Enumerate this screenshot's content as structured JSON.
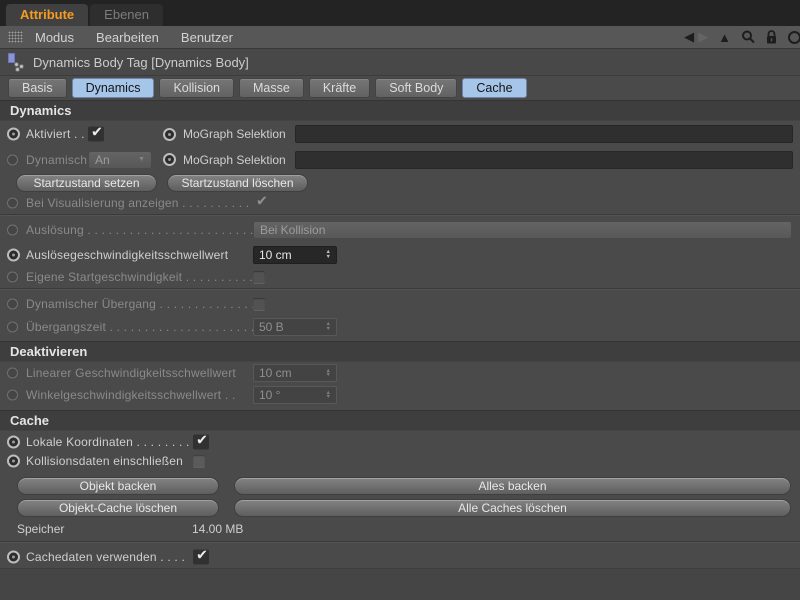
{
  "panel_tabs": {
    "attribute": "Attribute",
    "ebenen": "Ebenen"
  },
  "menubar": {
    "modus": "Modus",
    "bearbeiten": "Bearbeiten",
    "benutzer": "Benutzer"
  },
  "object_header": {
    "title": "Dynamics Body Tag [Dynamics Body]"
  },
  "tag_tabs": {
    "basis": "Basis",
    "dynamics": "Dynamics",
    "kollision": "Kollision",
    "masse": "Masse",
    "kraefte": "Kräfte",
    "soft_body": "Soft Body",
    "cache": "Cache"
  },
  "dynamics_section": {
    "title": "Dynamics",
    "aktiviert_label": "Aktiviert . . .",
    "mograph_label_1": "MoGraph Selektion",
    "mograph_value_1": "",
    "dynamisch_label": "Dynamisch",
    "dynamisch_value": "An",
    "mograph_label_2": "MoGraph Selektion",
    "mograph_value_2": "",
    "set_state_button": "Startzustand setzen",
    "clear_state_button": "Startzustand löschen",
    "visualize_label": "Bei Visualisierung anzeigen . . . . . . . . . .",
    "ausloesung_label": "Auslösung . . . . . . . . . . . . . . . . . . . . . . . . . . .",
    "ausloesung_value": "Bei Kollision",
    "threshold_label": "Auslösegeschwindigkeitsschwellwert",
    "threshold_value": "10 cm",
    "custom_start_label": "Eigene Startgeschwindigkeit . . . . . . . . . .",
    "transition_label": "Dynamischer Übergang . . . . . . . . . . . . . .",
    "transition_time_label": "Übergangszeit . . . . . . . . . . . . . . . . . . . . . .",
    "transition_time_value": "50 B"
  },
  "deactivate_section": {
    "title": "Deaktivieren",
    "linear_label": "Linearer Geschwindigkeitsschwellwert",
    "linear_value": "10 cm",
    "angular_label": "Winkelgeschwindigkeitsschwellwert . .",
    "angular_value": "10 °"
  },
  "cache_section": {
    "title": "Cache",
    "local_coords_label": "Lokale Koordinaten . . . . . . . .",
    "include_collision_label": "Kollisionsdaten einschließen",
    "bake_object_button": "Objekt backen",
    "bake_all_button": "Alles backen",
    "clear_object_button": "Objekt-Cache löschen",
    "clear_all_button": "Alle Caches löschen",
    "memory_label": "Speicher",
    "memory_value": "14.00 MB",
    "use_cache_label": "Cachedaten verwenden . . . ."
  },
  "icons": {
    "check": "✔",
    "dropdown_arrow": "▼",
    "spin_up": "▲",
    "spin_down": "▼",
    "back_arrow": "◀",
    "forward_arrow": "▶",
    "up_arrow": "▲"
  },
  "colors": {
    "accent_orange": "#f59b22",
    "selected_tab_blue": "#a6c6e9"
  }
}
